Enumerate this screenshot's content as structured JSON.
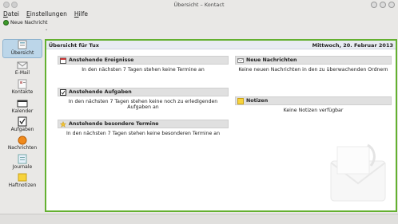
{
  "window": {
    "title": "Übersicht – Kontact"
  },
  "menu": [
    {
      "accel": "D",
      "rest": "atei"
    },
    {
      "accel": "E",
      "rest": "instellungen"
    },
    {
      "accel": "H",
      "rest": "ilfe"
    }
  ],
  "toolbar": {
    "new_message": "Neue Nachricht"
  },
  "sidebar": {
    "items": [
      {
        "label": "Übersicht",
        "icon": "overview-icon"
      },
      {
        "label": "E-Mail",
        "icon": "mail-icon"
      },
      {
        "label": "Kontakte",
        "icon": "contacts-icon"
      },
      {
        "label": "Kalender",
        "icon": "calendar-icon"
      },
      {
        "label": "Aufgaben",
        "icon": "tasks-icon"
      },
      {
        "label": "Nachrichten",
        "icon": "news-icon"
      },
      {
        "label": "Journale",
        "icon": "journal-icon"
      },
      {
        "label": "Haftnotizen",
        "icon": "notes-icon"
      }
    ]
  },
  "content": {
    "heading_left": "Übersicht für Tux",
    "heading_right": "Mittwoch, 20. Februar 2013",
    "left": [
      {
        "title": "Anstehende Ereignisse",
        "text": "In den nächsten 7 Tagen stehen keine Termine an"
      },
      {
        "title": "Anstehende Aufgaben",
        "text": "In den nächsten 7 Tagen stehen keine noch zu erledigenden Aufgaben an"
      },
      {
        "title": "Anstehende besondere Termine",
        "text": "In den nächsten 7 Tagen stehen keine besonderen Termine an"
      }
    ],
    "right": [
      {
        "title": "Neue Nachrichten",
        "text": "Keine neuen Nachrichten in den zu überwachenden Ordnern"
      },
      {
        "title": "Notizen",
        "text": "Keine Notizen verfügbar"
      }
    ]
  },
  "colors": {
    "active_border": "#64b030",
    "selected": "#bcd6e9"
  }
}
